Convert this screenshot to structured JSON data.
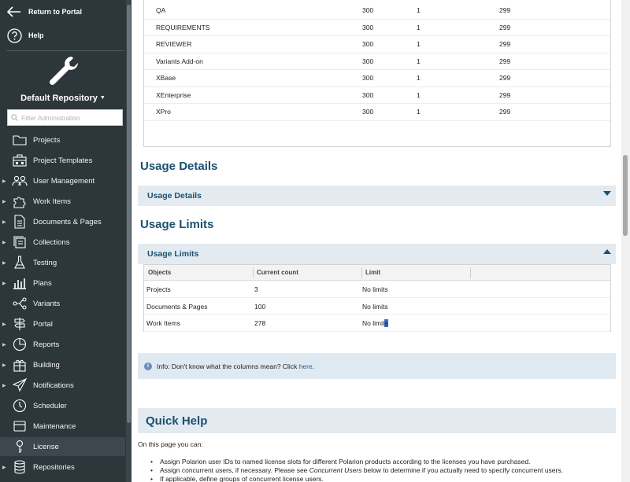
{
  "sidebar": {
    "return_label": "Return to Portal",
    "help_label": "Help",
    "repository": "Default Repository",
    "filter_placeholder": "Filter Administration",
    "items": [
      {
        "label": "Projects",
        "icon": "folder-icon",
        "expandable": false
      },
      {
        "label": "Project Templates",
        "icon": "template-icon",
        "expandable": false
      },
      {
        "label": "User Management",
        "icon": "users-icon",
        "expandable": true
      },
      {
        "label": "Work Items",
        "icon": "puzzle-icon",
        "expandable": true
      },
      {
        "label": "Documents & Pages",
        "icon": "document-icon",
        "expandable": true
      },
      {
        "label": "Collections",
        "icon": "collections-icon",
        "expandable": true
      },
      {
        "label": "Testing",
        "icon": "flask-icon",
        "expandable": true
      },
      {
        "label": "Plans",
        "icon": "plans-icon",
        "expandable": true
      },
      {
        "label": "Variants",
        "icon": "variants-icon",
        "expandable": false
      },
      {
        "label": "Portal",
        "icon": "signpost-icon",
        "expandable": true
      },
      {
        "label": "Reports",
        "icon": "pie-chart-icon",
        "expandable": true
      },
      {
        "label": "Building",
        "icon": "gift-icon",
        "expandable": true
      },
      {
        "label": "Notifications",
        "icon": "paper-plane-icon",
        "expandable": true
      },
      {
        "label": "Scheduler",
        "icon": "clock-icon",
        "expandable": false
      },
      {
        "label": "Maintenance",
        "icon": "maintenance-icon",
        "expandable": false
      },
      {
        "label": "License",
        "icon": "key-icon",
        "expandable": false,
        "active": true
      },
      {
        "label": "Repositories",
        "icon": "database-icon",
        "expandable": true
      }
    ]
  },
  "license_rows": [
    [
      "QA",
      "300",
      "1",
      "299"
    ],
    [
      "REQUIREMENTS",
      "300",
      "1",
      "299"
    ],
    [
      "REVIEWER",
      "300",
      "1",
      "299"
    ],
    [
      "Variants Add-on",
      "300",
      "1",
      "299"
    ],
    [
      "XBase",
      "300",
      "1",
      "299"
    ],
    [
      "XEnterprise",
      "300",
      "1",
      "299"
    ],
    [
      "XPro",
      "300",
      "1",
      "299"
    ]
  ],
  "usage_details": {
    "title": "Usage Details",
    "panel_title": "Usage Details"
  },
  "usage_limits": {
    "title": "Usage Limits",
    "panel_title": "Usage Limits",
    "columns": [
      "Objects",
      "Current count",
      "Limit"
    ],
    "rows": [
      [
        "Projects",
        "3",
        "No limits"
      ],
      [
        "Documents & Pages",
        "100",
        "No limits"
      ],
      [
        "Work Items",
        "278",
        "No limit",
        "s"
      ]
    ]
  },
  "info": {
    "text": "Info: Don't know what the columns mean? Click ",
    "link": "here",
    "suffix": "."
  },
  "quick_help": {
    "title": "Quick Help",
    "intro": "On this page you can:",
    "bullets": [
      "Assign Polarion user IDs to named license slots for different Polarion products according to the licenses you have purchased.",
      "Assign concurrent users, if necessary. Please see ",
      "If applicable, define groups of concurrent license users."
    ],
    "bullet2_em": "Concurrent Users",
    "bullet2_suffix": " below to determine if you actually need to specify concurrent users."
  },
  "colors": {
    "sidebar_bg": "#2d363b",
    "heading": "#1b5070",
    "panel_bg": "#e3ebf1",
    "info_bg": "#dfe9f2",
    "link": "#1a64a8"
  }
}
